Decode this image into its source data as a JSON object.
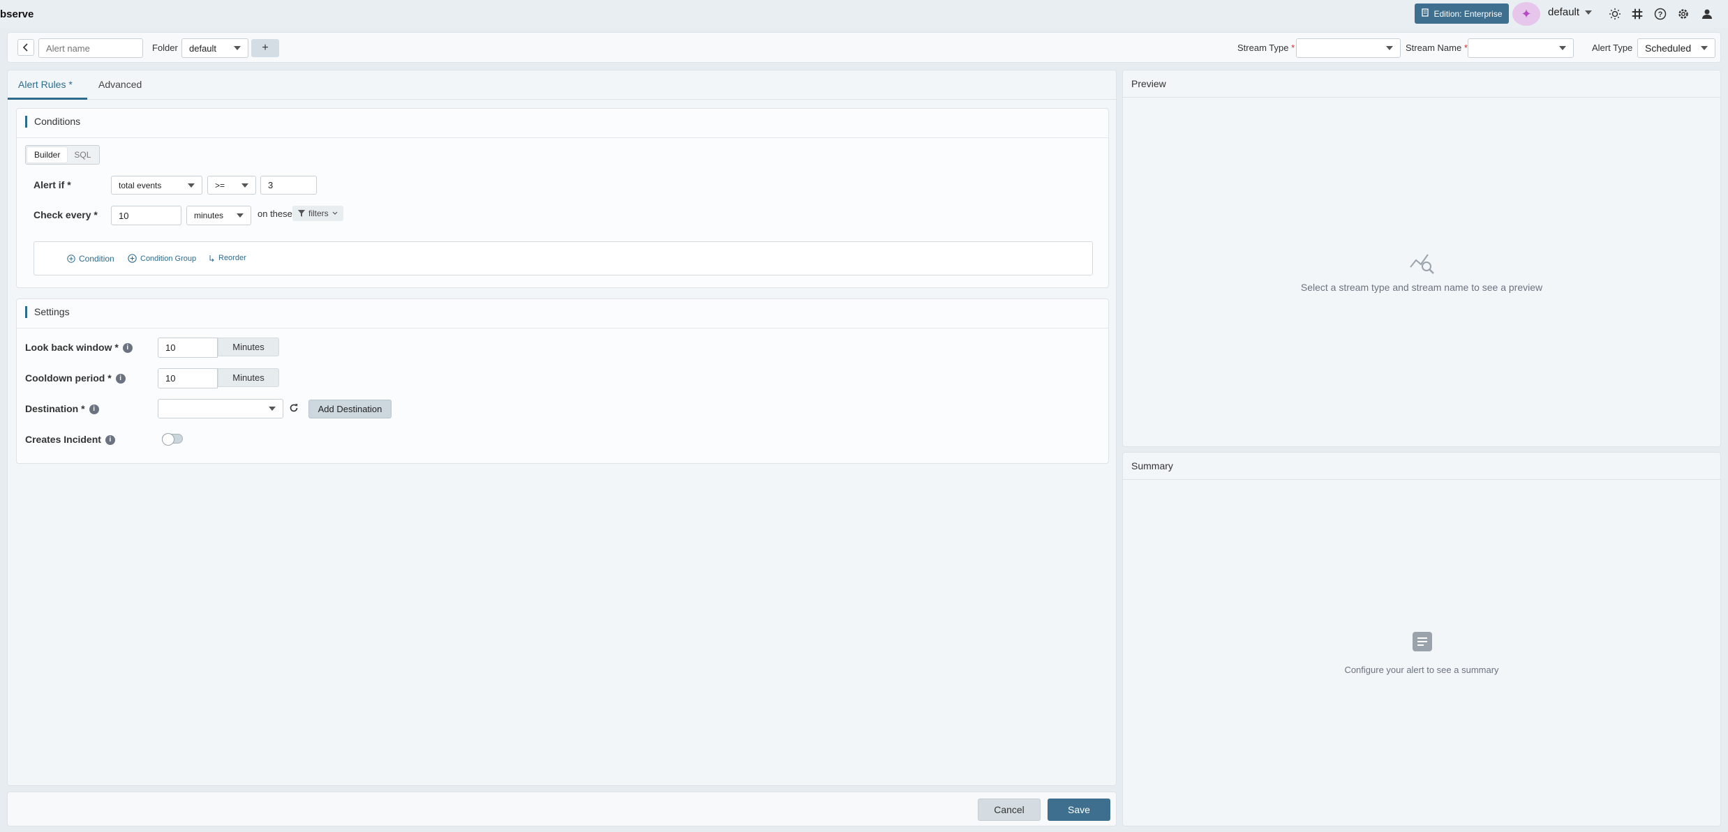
{
  "topnav": {
    "brand": "bserve",
    "edition_label": "Edition: Enterprise",
    "org_name": "default",
    "icons": [
      "theme-icon",
      "slack-icon",
      "help-icon",
      "settings-icon",
      "user-icon"
    ]
  },
  "header": {
    "alert_name_placeholder": "Alert name",
    "folder_label": "Folder",
    "folder_value": "default",
    "add_folder_label": "+",
    "stream_type_label": "Stream Type",
    "stream_type_value": "",
    "stream_name_label": "Stream Name",
    "stream_name_value": "",
    "required_mark": "*",
    "alert_type_label": "Alert Type",
    "alert_type_value": "Scheduled"
  },
  "tabs": [
    {
      "label": "Alert Rules *",
      "active": true
    },
    {
      "label": "Advanced",
      "active": false
    }
  ],
  "conditions": {
    "title": "Conditions",
    "mode_builder": "Builder",
    "mode_sql": "SQL",
    "alert_if_label": "Alert if *",
    "aggregate_value": "total events",
    "operator_value": ">=",
    "threshold_value": "3",
    "check_every_label": "Check every *",
    "frequency_value": "10",
    "frequency_unit": "minutes",
    "on_these_label": "on these",
    "filters_label": "filters",
    "add_condition_label": "Condition",
    "add_condition_group_label": "Condition Group",
    "reorder_label": "Reorder"
  },
  "settings": {
    "title": "Settings",
    "lookback_label": "Look back window *",
    "lookback_value": "10",
    "lookback_unit": "Minutes",
    "cooldown_label": "Cooldown period *",
    "cooldown_value": "10",
    "cooldown_unit": "Minutes",
    "destination_label": "Destination *",
    "destination_value": "",
    "add_destination_label": "Add Destination",
    "creates_incident_label": "Creates Incident",
    "creates_incident_on": false
  },
  "preview": {
    "title": "Preview",
    "empty_message": "Select a stream type and stream name to see a preview"
  },
  "summary": {
    "title": "Summary",
    "empty_message": "Configure your alert to see a summary"
  },
  "footer": {
    "cancel_label": "Cancel",
    "save_label": "Save"
  },
  "colors": {
    "accent": "#2d6b8c",
    "save_button": "#3f6f8e",
    "edition_button": "#3f6f8e",
    "ai_button": "#e7c6ec"
  }
}
